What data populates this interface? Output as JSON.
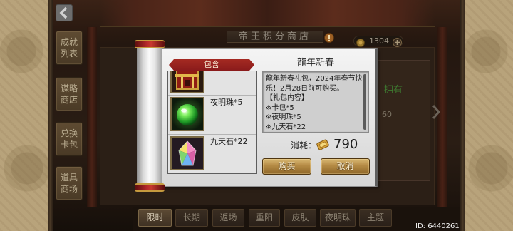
{
  "header": {
    "store_title": "帝王积分商店",
    "points": "1304",
    "icons": {
      "back": "back-chevron-icon",
      "alert": "alert-icon",
      "points": "coin-icon",
      "add": "plus-icon"
    }
  },
  "side_tabs": [
    {
      "label": "成就列表"
    },
    {
      "label": "谋略商店"
    },
    {
      "label": "兑换卡包"
    },
    {
      "label": "道具商场"
    }
  ],
  "background_shop": {
    "owned_label": "拥有",
    "count": "60",
    "next_icon": "right-arrow-icon"
  },
  "bottom_tabs": [
    {
      "label": "限时",
      "active": true
    },
    {
      "label": "长期",
      "active": false
    },
    {
      "label": "返场",
      "active": false
    },
    {
      "label": "重阳",
      "active": false
    },
    {
      "label": "皮肤",
      "active": false
    },
    {
      "label": "夜明珠",
      "active": false
    },
    {
      "label": "主题",
      "active": false
    }
  ],
  "dialog": {
    "contents_header": "包含",
    "items": [
      {
        "icon": "card-pack-icon"
      },
      {
        "icon": "pearl-icon",
        "name": "夜明珠*5"
      },
      {
        "icon": "crystal-icon",
        "name": "九天石*22"
      }
    ],
    "title": "龍年新春",
    "description_lines": [
      "龍年新春礼包，2024年春节快",
      "乐！2月28日前可购买。",
      "【礼包内容】",
      "※卡包*5",
      "※夜明珠*5",
      "※九天石*22"
    ],
    "cost_label": "消耗：",
    "cost_icon": "currency-icon",
    "cost_value": "790",
    "buy_label": "购买",
    "cancel_label": "取消"
  },
  "footer": {
    "user_id": "ID: 6440261"
  },
  "colors": {
    "banner_red": "#8a1b1b",
    "button_gold": "#b48a44",
    "owned_green": "#3e7a30",
    "active_tab_text": "#d6cbb6"
  }
}
